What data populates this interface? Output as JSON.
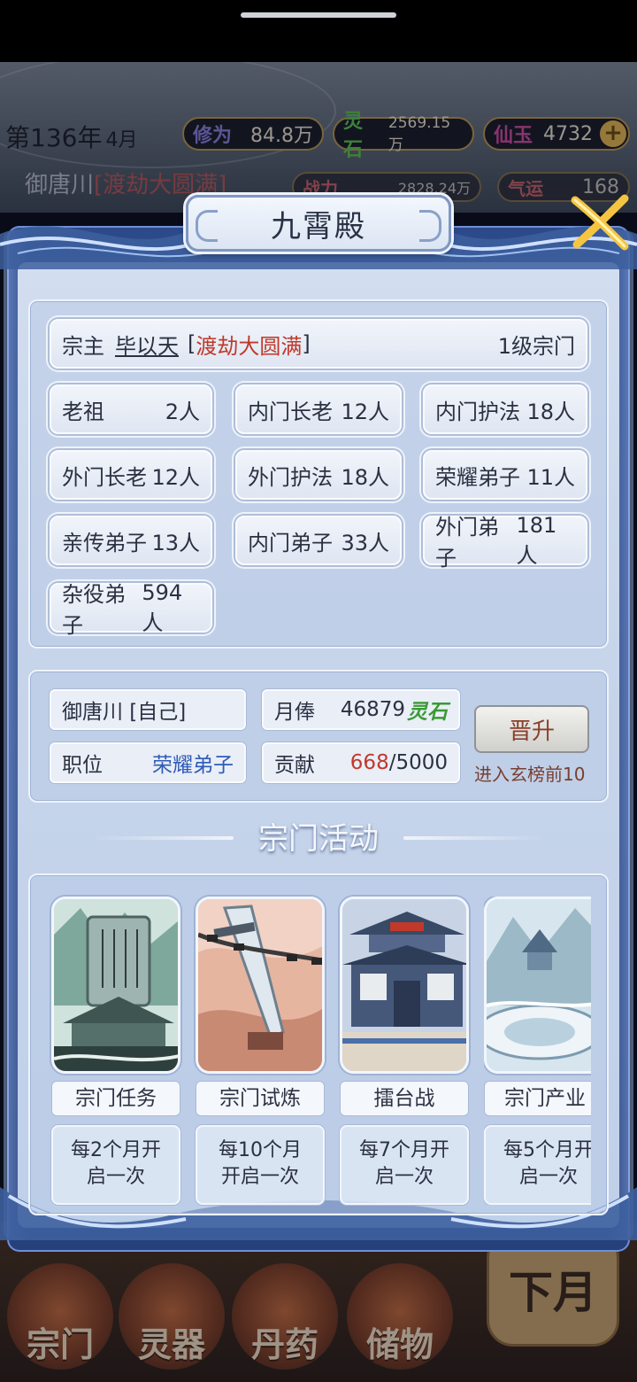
{
  "hud": {
    "year": "第136年",
    "month": "4月",
    "cultivation_label": "修为",
    "cultivation_value": "84.8万",
    "spirit_stone_label": "灵石",
    "spirit_stone_value": "2569.15万",
    "jade_label": "仙玉",
    "jade_value": "4732",
    "player_name": "御唐川",
    "player_realm": "[渡劫大圆满]",
    "power_label": "战力",
    "power_value": "2828.24万",
    "luck_label": "气运",
    "luck_value": "168"
  },
  "modal": {
    "title": "九霄殿"
  },
  "sect": {
    "leader_label": "宗主",
    "leader_name": "毕以天",
    "leader_realm_open": "[",
    "leader_realm": "渡劫大圆满",
    "leader_realm_close": "]",
    "level": "1级宗门",
    "members": [
      {
        "role": "老祖",
        "count": "2人"
      },
      {
        "role": "内门长老",
        "count": "12人"
      },
      {
        "role": "内门护法",
        "count": "18人"
      },
      {
        "role": "外门长老",
        "count": "12人"
      },
      {
        "role": "外门护法",
        "count": "18人"
      },
      {
        "role": "荣耀弟子",
        "count": "11人"
      },
      {
        "role": "亲传弟子",
        "count": "13人"
      },
      {
        "role": "内门弟子",
        "count": "33人"
      },
      {
        "role": "外门弟子",
        "count": "181人"
      },
      {
        "role": "杂役弟子",
        "count": "594人"
      }
    ]
  },
  "me": {
    "name": "御唐川 [自己]",
    "salary_label": "月俸",
    "salary_value": "46879",
    "salary_unit": "灵石",
    "position_label": "职位",
    "position_value": "荣耀弟子",
    "contribution_label": "贡献",
    "contribution_current": "668",
    "contribution_total": "/5000",
    "promote_label": "晋升",
    "promote_note": "进入玄榜前10"
  },
  "activities": {
    "title": "宗门活动",
    "items": [
      {
        "name": "宗门任务",
        "freq_line1": "每2个月开",
        "freq_line2": "启一次"
      },
      {
        "name": "宗门试炼",
        "freq_line1": "每10个月",
        "freq_line2": "开启一次"
      },
      {
        "name": "擂台战",
        "freq_line1": "每7个月开",
        "freq_line2": "启一次"
      },
      {
        "name": "宗门产业",
        "freq_line1": "每5个月开",
        "freq_line2": "启一次"
      }
    ]
  },
  "bottom_nav": {
    "items": [
      "宗门",
      "灵器",
      "丹药",
      "储物"
    ],
    "next_month": "下月"
  },
  "colors": {
    "frame_blue": "#2c4a8a",
    "panel_bg": "#c7d5ea",
    "realm_red": "#c0392b",
    "rank_blue": "#2f5bb8",
    "lingshi_green": "#3a9a34"
  }
}
